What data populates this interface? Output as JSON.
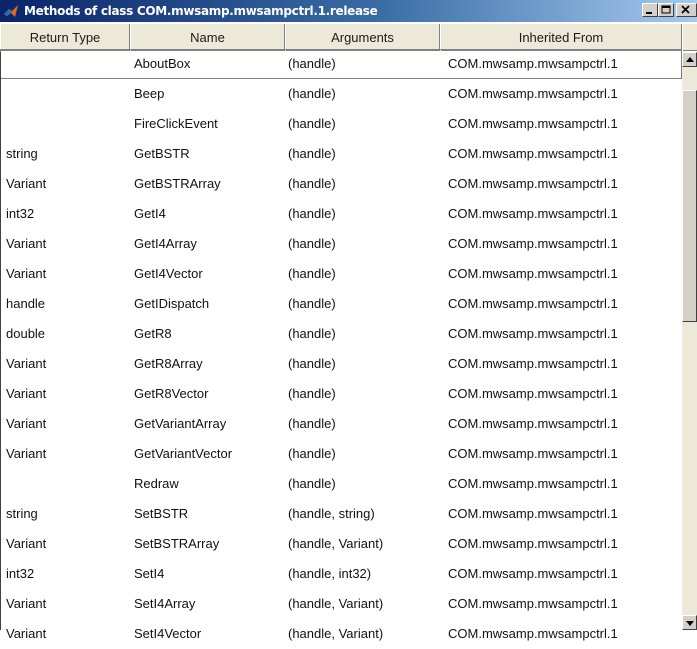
{
  "window": {
    "title": "Methods of class COM.mwsamp.mwsampctrl.1.release"
  },
  "columns": {
    "return_type": "Return Type",
    "name": "Name",
    "arguments": "Arguments",
    "inherited_from": "Inherited From"
  },
  "rows": [
    {
      "return_type": "",
      "name": "AboutBox",
      "arguments": "(handle)",
      "inherited_from": "COM.mwsamp.mwsampctrl.1"
    },
    {
      "return_type": "",
      "name": "Beep",
      "arguments": "(handle)",
      "inherited_from": "COM.mwsamp.mwsampctrl.1"
    },
    {
      "return_type": "",
      "name": "FireClickEvent",
      "arguments": "(handle)",
      "inherited_from": "COM.mwsamp.mwsampctrl.1"
    },
    {
      "return_type": "string",
      "name": "GetBSTR",
      "arguments": "(handle)",
      "inherited_from": "COM.mwsamp.mwsampctrl.1"
    },
    {
      "return_type": "Variant",
      "name": "GetBSTRArray",
      "arguments": "(handle)",
      "inherited_from": "COM.mwsamp.mwsampctrl.1"
    },
    {
      "return_type": "int32",
      "name": "GetI4",
      "arguments": "(handle)",
      "inherited_from": "COM.mwsamp.mwsampctrl.1"
    },
    {
      "return_type": "Variant",
      "name": "GetI4Array",
      "arguments": "(handle)",
      "inherited_from": "COM.mwsamp.mwsampctrl.1"
    },
    {
      "return_type": "Variant",
      "name": "GetI4Vector",
      "arguments": "(handle)",
      "inherited_from": "COM.mwsamp.mwsampctrl.1"
    },
    {
      "return_type": "handle",
      "name": "GetIDispatch",
      "arguments": "(handle)",
      "inherited_from": "COM.mwsamp.mwsampctrl.1"
    },
    {
      "return_type": "double",
      "name": "GetR8",
      "arguments": "(handle)",
      "inherited_from": "COM.mwsamp.mwsampctrl.1"
    },
    {
      "return_type": "Variant",
      "name": "GetR8Array",
      "arguments": "(handle)",
      "inherited_from": "COM.mwsamp.mwsampctrl.1"
    },
    {
      "return_type": "Variant",
      "name": "GetR8Vector",
      "arguments": "(handle)",
      "inherited_from": "COM.mwsamp.mwsampctrl.1"
    },
    {
      "return_type": "Variant",
      "name": "GetVariantArray",
      "arguments": "(handle)",
      "inherited_from": "COM.mwsamp.mwsampctrl.1"
    },
    {
      "return_type": "Variant",
      "name": "GetVariantVector",
      "arguments": "(handle)",
      "inherited_from": "COM.mwsamp.mwsampctrl.1"
    },
    {
      "return_type": "",
      "name": "Redraw",
      "arguments": "(handle)",
      "inherited_from": "COM.mwsamp.mwsampctrl.1"
    },
    {
      "return_type": "string",
      "name": "SetBSTR",
      "arguments": "(handle, string)",
      "inherited_from": "COM.mwsamp.mwsampctrl.1"
    },
    {
      "return_type": "Variant",
      "name": "SetBSTRArray",
      "arguments": "(handle, Variant)",
      "inherited_from": "COM.mwsamp.mwsampctrl.1"
    },
    {
      "return_type": "int32",
      "name": "SetI4",
      "arguments": "(handle, int32)",
      "inherited_from": "COM.mwsamp.mwsampctrl.1"
    },
    {
      "return_type": "Variant",
      "name": "SetI4Array",
      "arguments": "(handle, Variant)",
      "inherited_from": "COM.mwsamp.mwsampctrl.1"
    },
    {
      "return_type": "Variant",
      "name": "SetI4Vector",
      "arguments": "(handle, Variant)",
      "inherited_from": "COM.mwsamp.mwsampctrl.1"
    }
  ],
  "icons": {
    "app": "matlab-logo-icon",
    "minimize": "minimize-icon",
    "maximize": "maximize-icon",
    "close": "close-icon",
    "scroll_up": "arrow-up-icon",
    "scroll_down": "arrow-down-icon"
  },
  "colors": {
    "title_bar_start": "#0a246a",
    "title_bar_end": "#a6caf0",
    "header_bg": "#ece9d8"
  }
}
